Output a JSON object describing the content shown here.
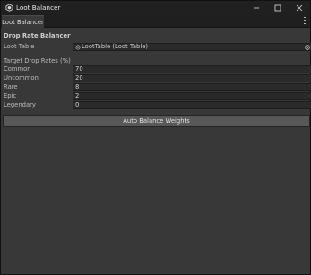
{
  "window": {
    "title": "Loot Balancer",
    "controls": {
      "minimize": "—",
      "maximize": "☐",
      "close": "✕"
    }
  },
  "tabs": [
    {
      "label": "Loot Balancer"
    }
  ],
  "panel": {
    "header": "Drop Rate Balancer",
    "loot_table": {
      "label": "Loot Table",
      "value": "LootTable (Loot Table)"
    },
    "section_label": "Target Drop Rates (%)",
    "rates": [
      {
        "label": "Common",
        "value": "70"
      },
      {
        "label": "Uncommon",
        "value": "20"
      },
      {
        "label": "Rare",
        "value": "8"
      },
      {
        "label": "Epic",
        "value": "2"
      },
      {
        "label": "Legendary",
        "value": "0"
      }
    ],
    "button": "Auto Balance Weights"
  }
}
